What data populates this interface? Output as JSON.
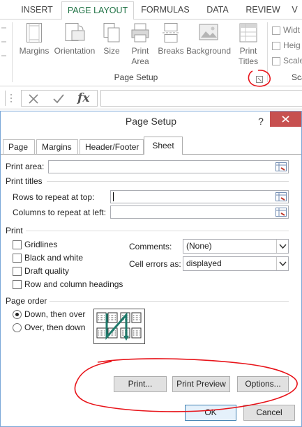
{
  "ribbon": {
    "tabs": [
      "INSERT",
      "PAGE LAYOUT",
      "FORMULAS",
      "DATA",
      "REVIEW",
      "V"
    ],
    "active_tab": "PAGE LAYOUT",
    "buttons": {
      "margins": "Margins",
      "orientation": "Orientation",
      "size": "Size",
      "print_area": "Print\nArea",
      "breaks": "Breaks",
      "background": "Background",
      "print_titles": "Print\nTitles"
    },
    "group_label": "Page Setup",
    "scale_group": {
      "width": "Widt",
      "height": "Heig",
      "scale": "Scale",
      "group_label_partial": "Sca"
    }
  },
  "formula_bar": {
    "fx_label": "fx"
  },
  "dialog": {
    "title": "Page Setup",
    "help": "?",
    "tabs": [
      "Page",
      "Margins",
      "Header/Footer",
      "Sheet"
    ],
    "active_tab": "Sheet",
    "print_area_label": "Print area:",
    "print_titles_label": "Print titles",
    "rows_label": "Rows to repeat at top:",
    "columns_label": "Columns to repeat at left:",
    "print_label": "Print",
    "checkboxes": {
      "gridlines": "Gridlines",
      "black_white": "Black and white",
      "draft_quality": "Draft quality",
      "row_col_headings": "Row and column headings"
    },
    "comments_label": "Comments:",
    "comments_value": "(None)",
    "errors_label": "Cell errors as:",
    "errors_value": "displayed",
    "page_order_label": "Page order",
    "down_then_over": "Down, then over",
    "over_then_down": "Over, then down",
    "buttons": {
      "print": "Print...",
      "print_preview": "Print Preview",
      "options": "Options...",
      "ok": "OK",
      "cancel": "Cancel"
    }
  },
  "colors": {
    "accent_green": "#217346",
    "annotation_red": "#e8141a",
    "close_red": "#c75050",
    "dialog_border": "#7aa7d8"
  }
}
